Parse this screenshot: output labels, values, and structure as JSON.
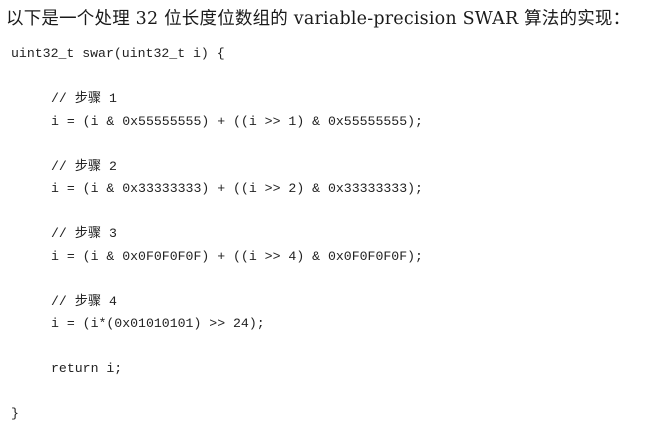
{
  "intro_text": "以下是一个处理 32 位长度位数组的 variable-precision SWAR 算法的实现：",
  "code": {
    "signature": "uint32_t swar(uint32_t i) {",
    "steps": [
      {
        "comment": "// 步骤 1",
        "statement": "i = (i & 0x55555555) + ((i >> 1) & 0x55555555);"
      },
      {
        "comment": "// 步骤 2",
        "statement": "i = (i & 0x33333333) + ((i >> 2) & 0x33333333);"
      },
      {
        "comment": "// 步骤 3",
        "statement": "i = (i & 0x0F0F0F0F) + ((i >> 4) & 0x0F0F0F0F);"
      },
      {
        "comment": "// 步骤 4",
        "statement": "i = (i*(0x01010101) >> 24);"
      }
    ],
    "return_statement": "return i;",
    "closing_brace": "}"
  }
}
